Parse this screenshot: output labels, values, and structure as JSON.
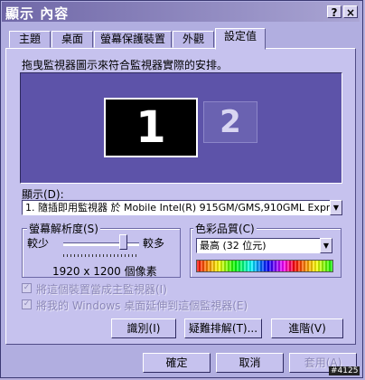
{
  "window": {
    "title": "顯示 內容"
  },
  "title_buttons": {
    "help": "?",
    "close": "×"
  },
  "tabs": [
    {
      "label": "主題"
    },
    {
      "label": "桌面"
    },
    {
      "label": "螢幕保護裝置"
    },
    {
      "label": "外觀"
    },
    {
      "label": "設定值"
    }
  ],
  "instructions": "拖曳監視器圖示來符合監視器實際的安排。",
  "monitors": [
    {
      "label": "1"
    },
    {
      "label": "2"
    }
  ],
  "display": {
    "label": "顯示(D):",
    "value": "1. 隨插即用監視器 於 Mobile Intel(R) 915GM/GMS,910GML Express"
  },
  "resolution": {
    "title": "螢幕解析度(S)",
    "less": "較少",
    "more": "較多",
    "value_text": "1920 x 1200 個像素"
  },
  "color_quality": {
    "title": "色彩品質(C)",
    "value": "最高 (32 位元)"
  },
  "checkboxes": [
    {
      "label": "將這個裝置當成主監視器(I)",
      "checked": true
    },
    {
      "label": "將我的 Windows 桌面延伸到這個監視器(E)",
      "checked": true
    }
  ],
  "panel_buttons": {
    "identify": "識別(I)",
    "troubleshoot": "疑難排解(T)...",
    "advanced": "進階(V)"
  },
  "dialog_buttons": {
    "ok": "確定",
    "cancel": "取消",
    "apply": "套用(A)"
  },
  "watermark": "#4125"
}
